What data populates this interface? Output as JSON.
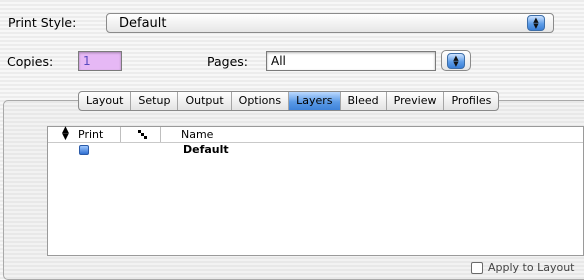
{
  "print_style": {
    "label": "Print Style:",
    "value": "Default"
  },
  "copies": {
    "label": "Copies:",
    "value": "1"
  },
  "pages": {
    "label": "Pages:",
    "value": "All"
  },
  "tabs": [
    {
      "label": "Layout"
    },
    {
      "label": "Setup"
    },
    {
      "label": "Output"
    },
    {
      "label": "Options"
    },
    {
      "label": "Layers",
      "active": true
    },
    {
      "label": "Bleed"
    },
    {
      "label": "Preview"
    },
    {
      "label": "Profiles"
    }
  ],
  "layers_table": {
    "headers": {
      "print": "Print",
      "name": "Name"
    },
    "rows": [
      {
        "print_checked": true,
        "name": "Default"
      }
    ]
  },
  "apply_to_layout": {
    "label": "Apply to Layout",
    "checked": false
  },
  "colors": {
    "accent": "#3e82d9",
    "copies_field": "#e6b8f5"
  }
}
